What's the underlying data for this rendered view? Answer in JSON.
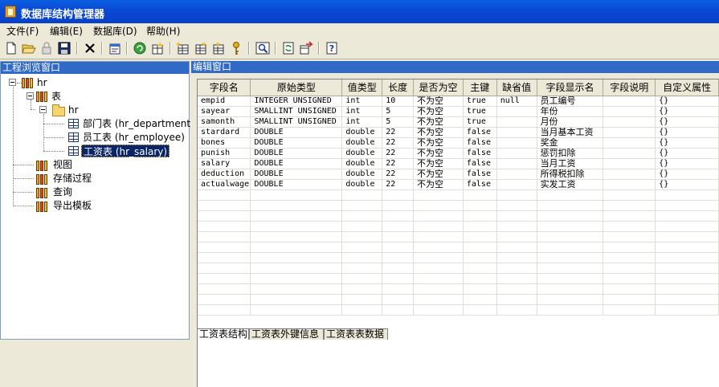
{
  "window": {
    "title": "数据库结构管理器"
  },
  "menu": [
    {
      "label": "文件(F)"
    },
    {
      "label": "编辑(E)"
    },
    {
      "label": "数据库(D)"
    },
    {
      "label": "帮助(H)"
    }
  ],
  "toolbar": [
    "new-icon",
    "open-icon",
    "lock-icon",
    "save-icon",
    "delete-icon",
    "properties-icon",
    "refresh-icon",
    "new-table-icon",
    "insert-field-icon",
    "field-list-icon",
    "add-index-icon",
    "key-icon",
    "preview-icon",
    "sync-icon",
    "export-icon",
    "help-icon"
  ],
  "left_panel": {
    "title": "工程浏览窗口",
    "tree": {
      "root": "hr",
      "tables_label": "表",
      "schema": "hr",
      "tables": [
        {
          "label": "部门表 (hr_department)"
        },
        {
          "label": "员工表 (hr_employee)"
        },
        {
          "label": "工资表 (hr_salary)",
          "selected": true
        }
      ],
      "others": [
        "视图",
        "存储过程",
        "查询",
        "导出模板"
      ]
    }
  },
  "right_panel": {
    "title": "编辑窗口",
    "columns": [
      "字段名",
      "原始类型",
      "值类型",
      "长度",
      "是否为空",
      "主键",
      "缺省值",
      "字段显示名",
      "字段说明",
      "自定义属性"
    ],
    "rows": [
      [
        "empid",
        "INTEGER UNSIGNED",
        "int",
        "10",
        "不为空",
        "true",
        "null",
        "员工编号",
        "",
        "{}"
      ],
      [
        "sayear",
        "SMALLINT UNSIGNED",
        "int",
        "5",
        "不为空",
        "true",
        "",
        "年份",
        "",
        "{}"
      ],
      [
        "samonth",
        "SMALLINT UNSIGNED",
        "int",
        "5",
        "不为空",
        "true",
        "",
        "月份",
        "",
        "{}"
      ],
      [
        "stardard",
        "DOUBLE",
        "double",
        "22",
        "不为空",
        "false",
        "",
        "当月基本工资",
        "",
        "{}"
      ],
      [
        "bones",
        "DOUBLE",
        "double",
        "22",
        "不为空",
        "false",
        "",
        "奖金",
        "",
        "{}"
      ],
      [
        "punish",
        "DOUBLE",
        "double",
        "22",
        "不为空",
        "false",
        "",
        "惩罚扣除",
        "",
        "{}"
      ],
      [
        "salary",
        "DOUBLE",
        "double",
        "22",
        "不为空",
        "false",
        "",
        "当月工资",
        "",
        "{}"
      ],
      [
        "deduction",
        "DOUBLE",
        "double",
        "22",
        "不为空",
        "false",
        "",
        "所得税扣除",
        "",
        "{}"
      ],
      [
        "actualwage",
        "DOUBLE",
        "double",
        "22",
        "不为空",
        "false",
        "",
        "实发工资",
        "",
        "{}"
      ]
    ],
    "empty_rows": 12,
    "tabs": [
      {
        "label": "工资表结构",
        "active": true
      },
      {
        "label": "工资表外键信息"
      },
      {
        "label": "工资表表数据"
      }
    ]
  },
  "colors": {
    "title_bar": "#0a48d4",
    "panel_header": "#3169c6",
    "selection": "#0a246a"
  }
}
